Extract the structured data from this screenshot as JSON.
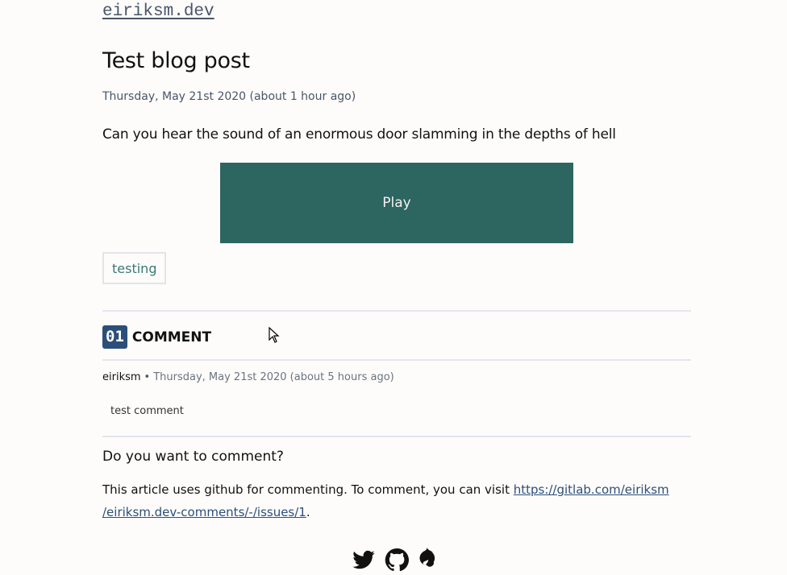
{
  "site": {
    "title": "eiriksm.dev"
  },
  "post": {
    "title": "Test blog post",
    "date": "Thursday, May 21st 2020 (about 1 hour ago)",
    "body": "Can you hear the sound of an enormous door slamming in the depths of hell",
    "play_label": "Play",
    "tags": [
      "testing"
    ]
  },
  "comments": {
    "count": "01",
    "label": "COMMENT",
    "items": [
      {
        "author": "eiriksm",
        "separator": "•",
        "date": "Thursday, May 21st 2020 (about 5 hours ago)",
        "text": "test comment"
      }
    ]
  },
  "cta": {
    "heading": "Do you want to comment?",
    "text_before": "This article uses github for commenting. To comment, you can visit ",
    "link_line1": "https://gitlab.com/eiriksm",
    "link_line2": "/eiriksm.dev-comments/-/issues/1",
    "text_after": "."
  },
  "social": {
    "icons": [
      "twitter-icon",
      "github-icon",
      "drupal-icon"
    ]
  },
  "colors": {
    "play_button": "#2d6560",
    "badge": "#2c4f79",
    "tag_text": "#3b7a74"
  }
}
